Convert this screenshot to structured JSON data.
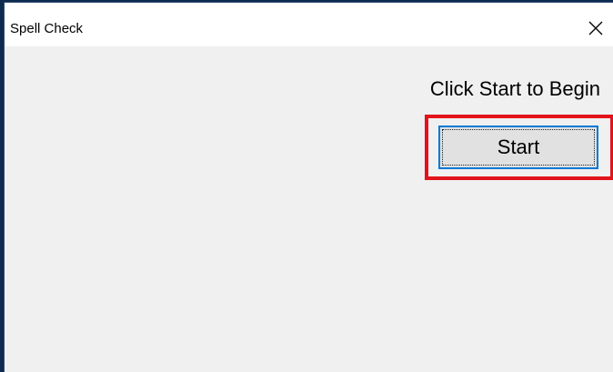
{
  "window": {
    "title": "Spell Check"
  },
  "main": {
    "prompt": "Click Start to Begin",
    "start_label": "Start"
  },
  "colors": {
    "highlight": "#e3131b",
    "focus": "#0078d7"
  },
  "icons": {
    "close": "close-icon"
  }
}
